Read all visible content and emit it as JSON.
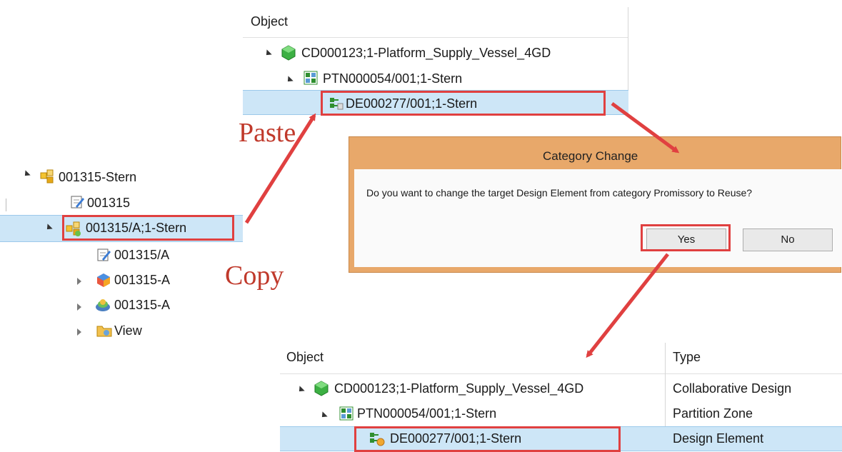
{
  "annotations": {
    "paste": "Paste",
    "copy": "Copy"
  },
  "left_tree": {
    "items": [
      {
        "label": "001315-Stern"
      },
      {
        "label": "001315"
      },
      {
        "label": "001315/A;1-Stern"
      },
      {
        "label": "001315/A"
      },
      {
        "label": "001315-A"
      },
      {
        "label": "001315-A"
      },
      {
        "label": "View"
      }
    ]
  },
  "top_panel": {
    "header": "Object",
    "rows": [
      {
        "label": "CD000123;1-Platform_Supply_Vessel_4GD"
      },
      {
        "label": "PTN000054/001;1-Stern"
      },
      {
        "label": "DE000277/001;1-Stern"
      }
    ]
  },
  "dialog": {
    "title": "Category Change",
    "message": "Do you want to change the target Design Element from category Promissory to Reuse?",
    "yes_label": "Yes",
    "no_label": "No"
  },
  "bottom_panel": {
    "headers": {
      "object": "Object",
      "type": "Type"
    },
    "rows": [
      {
        "label": "CD000123;1-Platform_Supply_Vessel_4GD",
        "type": "Collaborative Design"
      },
      {
        "label": "PTN000054/001;1-Stern",
        "type": "Partition Zone"
      },
      {
        "label": "DE000277/001;1-Stern",
        "type": "Design Element"
      }
    ]
  },
  "colors": {
    "selection": "#cde6f7",
    "annotation": "#e04040",
    "dialog_frame": "#e8a86a"
  }
}
